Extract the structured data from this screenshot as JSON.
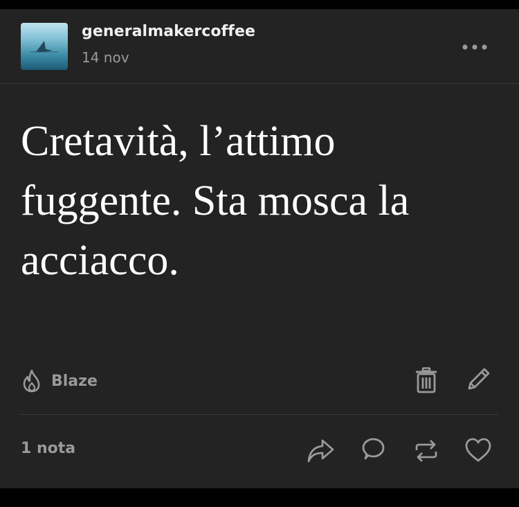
{
  "post": {
    "username": "generalmakercoffee",
    "date": "14 nov",
    "text": "Cretavità, l’attimo fuggente. Sta mosca la acciacco.",
    "blaze_label": "Blaze",
    "notes_label": "1 nota"
  },
  "icons": {
    "more": "more-dots-icon",
    "blaze": "flame-icon",
    "delete": "trash-icon",
    "edit": "pencil-icon",
    "share": "share-arrow-icon",
    "reply": "speech-bubble-icon",
    "reblog": "reblog-icon",
    "like": "heart-icon"
  },
  "colors": {
    "background": "#232323",
    "text": "#ffffff",
    "muted": "#9a9a9a",
    "divider": "#3a3a3a"
  }
}
